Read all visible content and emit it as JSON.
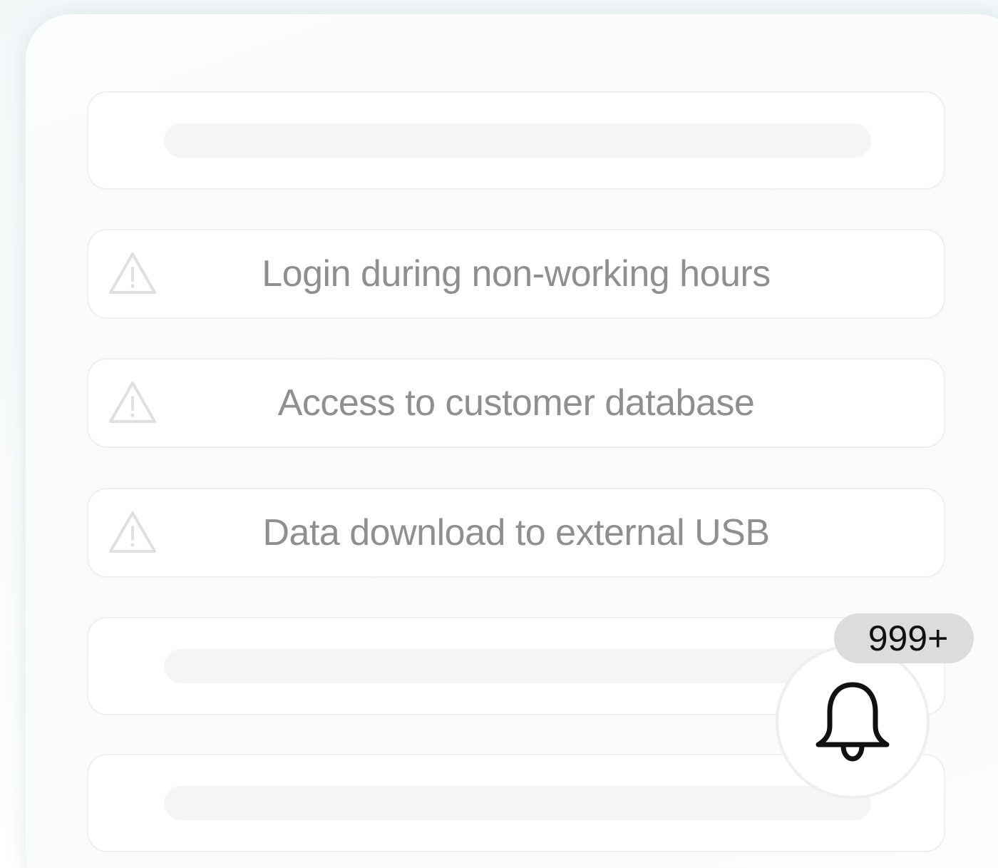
{
  "alerts": [
    {
      "label": "Login during non-working hours",
      "icon": "warning-triangle-icon"
    },
    {
      "label": "Access to customer database",
      "icon": "warning-triangle-icon"
    },
    {
      "label": "Data download to external USB",
      "icon": "warning-triangle-icon"
    }
  ],
  "notifications": {
    "icon": "bell-icon",
    "count_badge": "999+"
  },
  "colors": {
    "alert_text": "#8e8f91",
    "icon_stroke": "#dfe0e1",
    "skeleton": "#f4f5f5",
    "badge_bg": "#dcdcdc",
    "bell_stroke": "#111111"
  }
}
